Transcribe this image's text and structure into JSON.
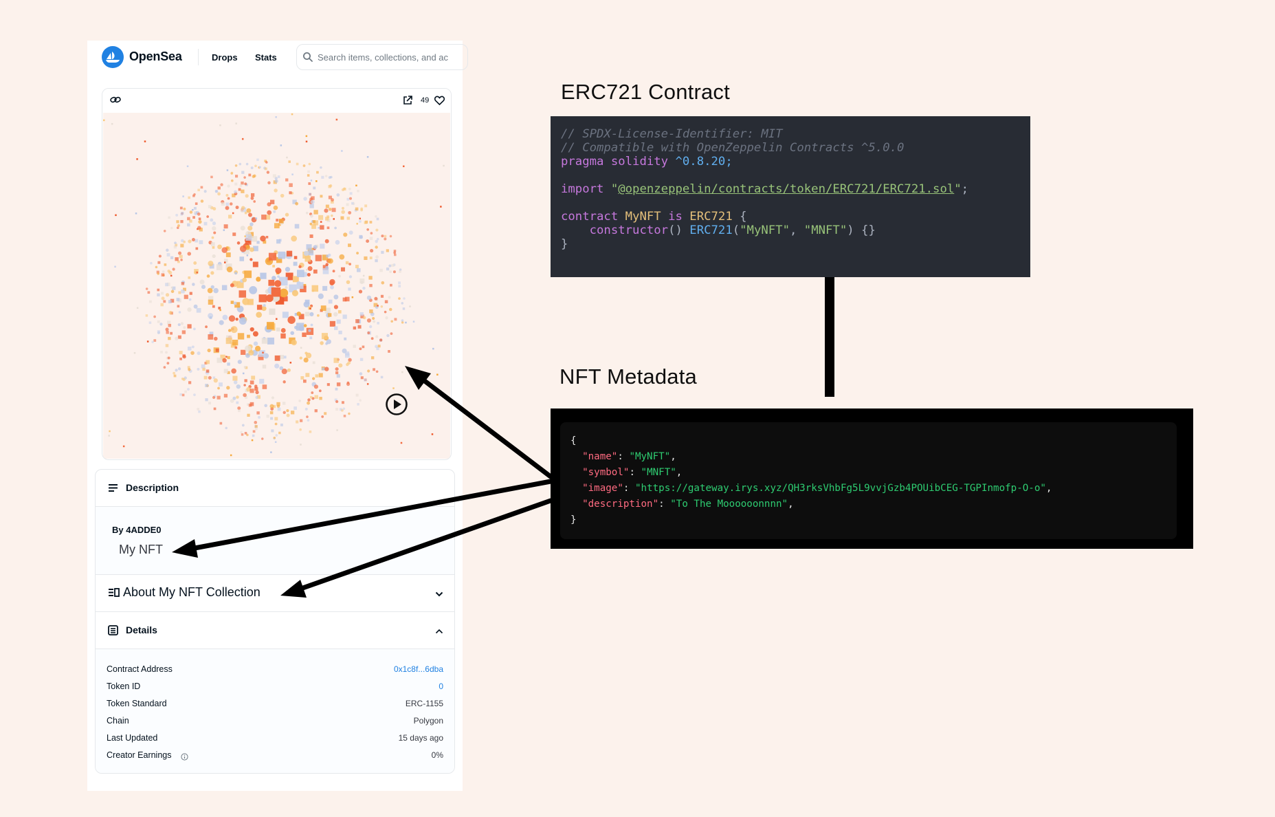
{
  "opensea": {
    "brand": "OpenSea",
    "nav": {
      "drops": "Drops",
      "stats": "Stats"
    },
    "search_placeholder": "Search items, collections, and ac",
    "like_count": "49",
    "description_title": "Description",
    "creator": "By 4ADDE0",
    "nft_name": "My NFT",
    "about_title": "About My NFT Collection",
    "details_title": "Details",
    "details": [
      {
        "label": "Contract Address",
        "value": "0x1c8f...6dba",
        "link": true
      },
      {
        "label": "Token ID",
        "value": "0",
        "link": true
      },
      {
        "label": "Token Standard",
        "value": "ERC-1155",
        "link": false
      },
      {
        "label": "Chain",
        "value": "Polygon",
        "link": false
      },
      {
        "label": "Last Updated",
        "value": "15 days ago",
        "link": false
      },
      {
        "label": "Creator Earnings",
        "value": "0%",
        "link": false
      }
    ]
  },
  "contract": {
    "title": "ERC721 Contract",
    "line1": "// SPDX-License-Identifier: MIT",
    "line2": "// Compatible with OpenZeppelin Contracts ^5.0.0",
    "pragma_kw": "pragma solidity",
    "pragma_ver": "^0.8.20;",
    "import_kw": "import",
    "import_path": "@openzeppelin/contracts/token/ERC721/ERC721.sol",
    "contract_kw": "contract",
    "contract_name": "MyNFT",
    "is_kw": "is",
    "base": "ERC721",
    "ctor": "constructor",
    "ctor_base": "ERC721",
    "arg1": "\"MyNFT\"",
    "arg2": "\"MNFT\""
  },
  "metadata": {
    "title": "NFT Metadata",
    "fields": [
      {
        "key": "\"name\"",
        "value": "\"MyNFT\""
      },
      {
        "key": "\"symbol\"",
        "value": "\"MNFT\""
      },
      {
        "key": "\"image\"",
        "value": "\"https://gateway.irys.xyz/QH3rksVhbFg5L9vvjGzb4POUibCEG-TGPInmofp-O-o\""
      },
      {
        "key": "\"description\"",
        "value": "\"To The Moooooonnnn\""
      }
    ]
  },
  "colors": {
    "accent": "#2081e2",
    "art_palette": [
      "#f26a3f",
      "#f6a93b",
      "#f9c87a",
      "#c9d3ec",
      "#b7c6e6",
      "#e8dfd6",
      "#ee5a2e"
    ]
  }
}
